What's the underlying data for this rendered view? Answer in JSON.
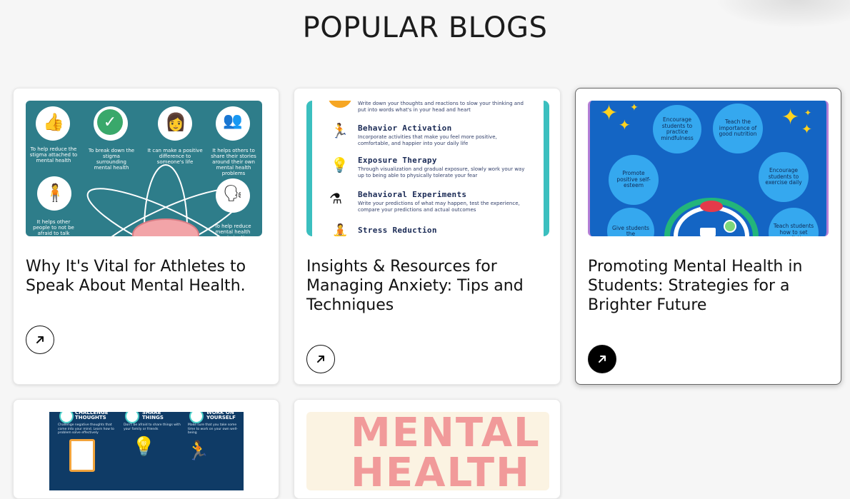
{
  "page": {
    "title": "POPULAR BLOGS"
  },
  "cards": [
    {
      "title": "Why It's Vital for Athletes to Speak About Mental Health.",
      "thumb": {
        "icons": [
          "thumbs-up-icon",
          "check-circle-icon",
          "woman-face-icon",
          "two-people-talking-icon",
          "sad-person-icon",
          "person-with-speech-icon"
        ],
        "captions": [
          "To help reduce the stigma attached to mental health",
          "To break down the stigma surrounding mental health",
          "It can make a positive difference to someone's life",
          "It helps others to share their stories around their own mental health problems",
          "It helps other people to not be afraid to talk about their",
          "To help reduce mental health discrimination"
        ],
        "background": "#2e7d8a"
      }
    },
    {
      "title": "Insights & Resources for Managing Anxiety: Tips and Techniques",
      "thumb": {
        "top_text": "Write down your thoughts and reactions to slow your thinking and put into words what's in your head and heart",
        "steps": [
          {
            "title": "Behavior Activation",
            "desc": "Incorporate activities that make you feel more positive, comfortable, and happier into your daily life",
            "icon": "running-person-icon"
          },
          {
            "title": "Exposure Therapy",
            "desc": "Through visualization and gradual exposure, slowly work your way up to being able to physically tolerate your fear",
            "icon": "head-lightbulb-icon"
          },
          {
            "title": "Behavioral Experiments",
            "desc": "Write your predictions of what may happen, test the experience, compare your predictions and actual outcomes",
            "icon": "flasks-icon"
          },
          {
            "title": "Stress Reduction",
            "desc": "",
            "icon": "meditation-icon"
          }
        ],
        "accent": "#3bbfbf"
      }
    },
    {
      "title": "Promoting Mental Health in Students: Strategies for a Brighter Future",
      "thumb": {
        "bubbles": [
          "Encourage students to practice mindfulness",
          "Teach the importance of good nutrition",
          "Promote positive self-esteem",
          "Encourage students to exercise daily",
          "Give students the",
          "Teach students how to set realistic"
        ],
        "background": "#1465c4",
        "bubble_color": "#35a8ef"
      }
    },
    {
      "title": "",
      "thumb": {
        "headings": [
          "CHALLENGE THOUGHTS",
          "SHARE THINGS",
          "WORK ON YOURSELF"
        ],
        "descs": [
          "Challenge negative thoughts that come into your mind. Learn how to problem solve effectively",
          "Don't be afraid to share things with your family or friends",
          "Make sure that you take some time to work on your own well-being"
        ],
        "background": "#0f3b66"
      }
    },
    {
      "title": "",
      "thumb": {
        "words": [
          "MENTAL",
          "HEALTH"
        ],
        "text_color": "#f19a9a",
        "background": "#fbf3e2"
      }
    }
  ],
  "colors": {
    "page_bg": "#f6f6f6",
    "card_bg": "#ffffff",
    "active_button": "#000000"
  }
}
